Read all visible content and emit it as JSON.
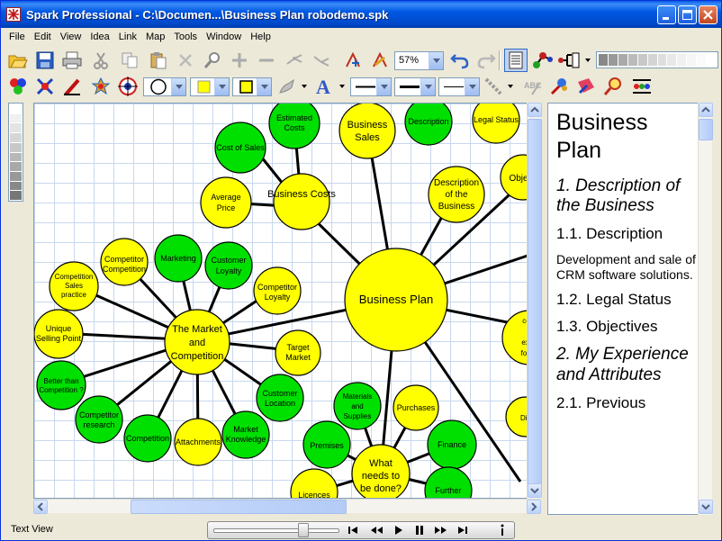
{
  "window": {
    "title": "Spark Professional - C:\\Documen...\\Business Plan robodemo.spk",
    "title_color": "#0054e3"
  },
  "menu": [
    "File",
    "Edit",
    "View",
    "Idea",
    "Link",
    "Map",
    "Tools",
    "Window",
    "Help"
  ],
  "toolbar": {
    "zoom": "57%",
    "icons_row1": [
      "open-folder-icon",
      "save-icon",
      "print-icon",
      "cut-icon",
      "copy-icon",
      "paste-icon",
      "delete-icon",
      "find-icon",
      "add-idea-icon",
      "remove-idea-icon",
      "expand-branch-icon",
      "collapse-branch-icon",
      "add-child-icon",
      "edit-idea-icon",
      "undo-icon",
      "redo-icon",
      "outline-view-icon",
      "link-ideas-icon",
      "outline-layout-icon"
    ],
    "icons_row2": [
      "style-palette-icon",
      "star-burst-icon",
      "pen-icon",
      "color-wheel-icon",
      "target-icon",
      "shape-circle-icon",
      "fill-color-icon",
      "line-color-icon",
      "paint-brush-icon",
      "font-icon",
      "line-style-icon",
      "line-weight-icon",
      "link-style-icon",
      "spell-check-icon",
      "paint-icon",
      "tag-icon",
      "magnify-icon",
      "presentation-icon"
    ]
  },
  "map": {
    "center": "Business Plan",
    "colors": {
      "yellow": "#ffff00",
      "green": "#00e000",
      "link": "#000000"
    },
    "nodes": [
      "Business Costs",
      "Cost of Sales",
      "Estimated Costs",
      "Average Price",
      "Business Sales",
      "Description",
      "Legal Status",
      "Description of the Business",
      "Obje",
      "The Market and Competition",
      "Marketing",
      "Customer Loyalty",
      "Competitor Competition",
      "Competitor Loyalty",
      "Competition Sales practice",
      "Unique Selling Point",
      "Target Market",
      "Better than Competition ?",
      "Customer Location",
      "Competitor research",
      "Competition",
      "Attachments",
      "Market Knowledge",
      "Materials and Supplies",
      "Purchases",
      "Premises",
      "What needs to be done?",
      "Finance",
      "Licences",
      "Further",
      "contri a expec for the",
      "Disa"
    ]
  },
  "text_view": {
    "title": "Business Plan",
    "items": [
      {
        "kind": "h1",
        "text": "1. Description of the Business"
      },
      {
        "kind": "h2",
        "text": "1.1. Description"
      },
      {
        "kind": "body",
        "text": "Development and sale of CRM software solutions."
      },
      {
        "kind": "h2",
        "text": "1.2. Legal Status"
      },
      {
        "kind": "h2",
        "text": "1.3. Objectives"
      },
      {
        "kind": "h1",
        "text": "2. My Experience and Attributes"
      },
      {
        "kind": "h2",
        "text": "2.1. Previous"
      }
    ]
  },
  "status": {
    "text": "Text View"
  }
}
